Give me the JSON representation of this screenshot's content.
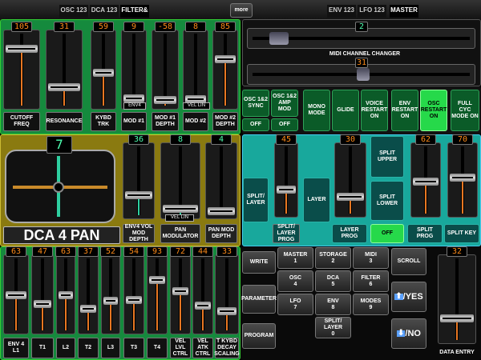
{
  "tabs_left": [
    {
      "label": "OSC 123",
      "active": false
    },
    {
      "label": "DCA 123",
      "active": false
    },
    {
      "label": "FILTER&",
      "active": true
    }
  ],
  "more_label": "more",
  "tabs_right": [
    {
      "label": "ENV 123",
      "active": false
    },
    {
      "label": "LFO 123",
      "active": false
    },
    {
      "label": "MASTER",
      "active": true
    }
  ],
  "filter": {
    "sliders": [
      {
        "value": "105",
        "label": "CUTOFF FREQ"
      },
      {
        "value": "31",
        "label": "RESONANCE"
      },
      {
        "value": "59",
        "label": "KYBD TRK"
      },
      {
        "value": "9",
        "label": "MOD #1"
      },
      {
        "value": "-58",
        "label": "MOD #1 DEPTH"
      },
      {
        "value": "8",
        "label": "MOD #2"
      },
      {
        "value": "85",
        "label": "MOD #2 DEPTH"
      }
    ],
    "mod1_source": "ENV4",
    "mod2_source": "VEL LIN"
  },
  "midi": {
    "value": "2",
    "label": "MIDI CHANNEL CHANGER",
    "value2": "31"
  },
  "master_buttons": [
    {
      "label": "OSC 1&2 SYNC",
      "state": "OFF",
      "on": false
    },
    {
      "label": "OSC 1&2 AMP MOD",
      "state": "OFF",
      "on": false
    },
    {
      "label": "MONO MODE",
      "on": false
    },
    {
      "label": "GLIDE",
      "on": false
    },
    {
      "label": "VOICE RESTART ON",
      "on": false
    },
    {
      "label": "ENV RESTART ON",
      "on": false
    },
    {
      "label": "OSC RESTART ON",
      "on": true
    },
    {
      "label": "FULL CYC MODE ON",
      "on": false
    }
  ],
  "pan": {
    "value": "7",
    "title": "DCA 4 PAN",
    "sliders": [
      {
        "value": "36",
        "label": "ENV4 VOL MOD DEPTH"
      },
      {
        "value": "8",
        "label": "PAN MODULATOR",
        "source": "VEL LIN"
      },
      {
        "value": "4",
        "label": "PAN MOD DEPTH"
      }
    ]
  },
  "split": {
    "split_layer_btn": "SPLIT/ LAYER",
    "layer_prog_value": "45",
    "layer_prog_label": "SPLIT/ LAYER PROG",
    "layer_btn": "LAYER",
    "layer_slider_value": "30",
    "layer_prog": "LAYER PROG",
    "split_upper": "SPLIT UPPER",
    "split_lower": "SPLIT LOWER",
    "off": "OFF",
    "split_prog_value": "62",
    "split_prog": "SPLIT PROG",
    "split_key_value": "70",
    "split_key": "SPLIT KEY"
  },
  "env4": {
    "sliders": [
      {
        "value": "63",
        "label": "ENV 4 L1"
      },
      {
        "value": "47",
        "label": "T1"
      },
      {
        "value": "63",
        "label": "L2"
      },
      {
        "value": "37",
        "label": "T2"
      },
      {
        "value": "52",
        "label": "L3"
      },
      {
        "value": "54",
        "label": "T3"
      },
      {
        "value": "93",
        "label": "T4"
      },
      {
        "value": "72",
        "label": "VEL LVL CTRL"
      },
      {
        "value": "44",
        "label": "VEL ATK CTRL"
      },
      {
        "value": "33",
        "label": "T KYBD DECAY SCALING"
      }
    ]
  },
  "keypad": {
    "left": [
      "WRITE",
      "PARAMETER",
      "PROGRAM"
    ],
    "keys": [
      [
        "MASTER\n1",
        "STORAGE\n2",
        "MIDI\n3"
      ],
      [
        "OSC\n4",
        "DCA\n5",
        "FILTER\n6"
      ],
      [
        "LFO\n7",
        "ENV\n8",
        "MODES\n9"
      ],
      [
        "",
        "SPLIT/\nLAYER\n0",
        ""
      ]
    ],
    "scroll": "SCROLL",
    "yes": "/YES",
    "no": "/NO"
  },
  "data_entry": {
    "value": "32",
    "label": "DATA ENTRY"
  }
}
